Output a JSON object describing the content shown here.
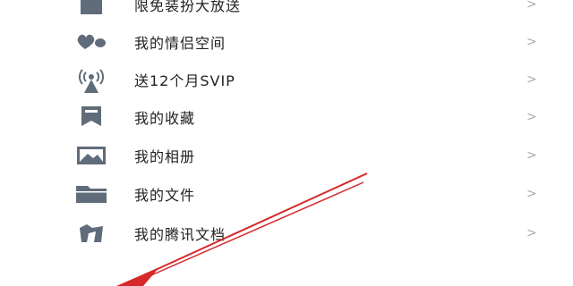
{
  "menu": {
    "items": [
      {
        "label": "限免装扮大放送",
        "icon": "shirt-icon"
      },
      {
        "label": "我的情侣空间",
        "icon": "couple-heart-icon"
      },
      {
        "label": "送12个月SVIP",
        "icon": "broadcast-tower-icon"
      },
      {
        "label": "我的收藏",
        "icon": "bookmark-icon"
      },
      {
        "label": "我的相册",
        "icon": "photo-album-icon"
      },
      {
        "label": "我的文件",
        "icon": "folder-icon"
      },
      {
        "label": "我的腾讯文档",
        "icon": "tencent-docs-icon"
      }
    ],
    "chevron": ">"
  },
  "colors": {
    "icon": "#606c7a",
    "text": "#222222",
    "chevron": "#aaaaaa",
    "annotation_arrow": "#d62828"
  }
}
